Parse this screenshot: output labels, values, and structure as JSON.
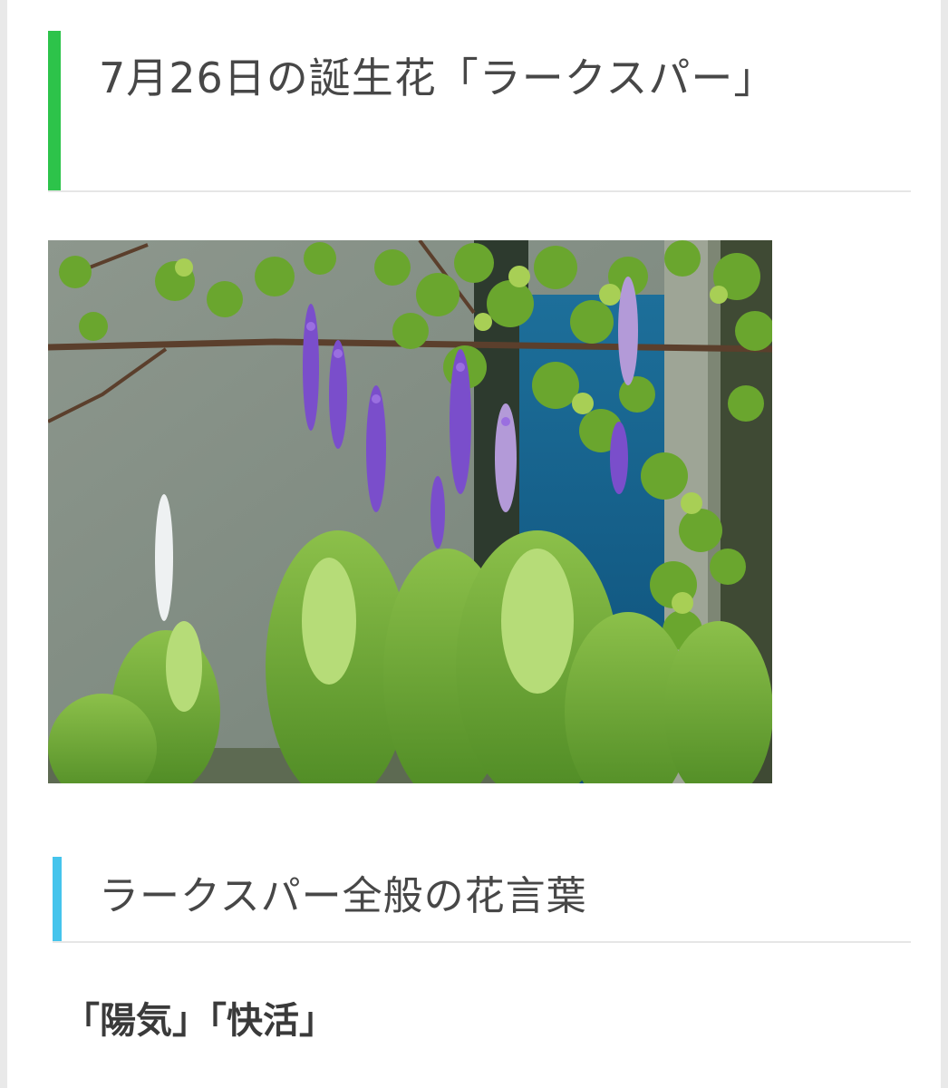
{
  "article": {
    "title": "7月26日の誕生花「ラークスパー」",
    "title_accent_color": "#2dc34a",
    "image_alt": "ラークスパー",
    "section_heading": "ラークスパー全般の花言葉",
    "section_accent_color": "#45c4ec",
    "flower_meanings": "「陽気」「快活」"
  }
}
